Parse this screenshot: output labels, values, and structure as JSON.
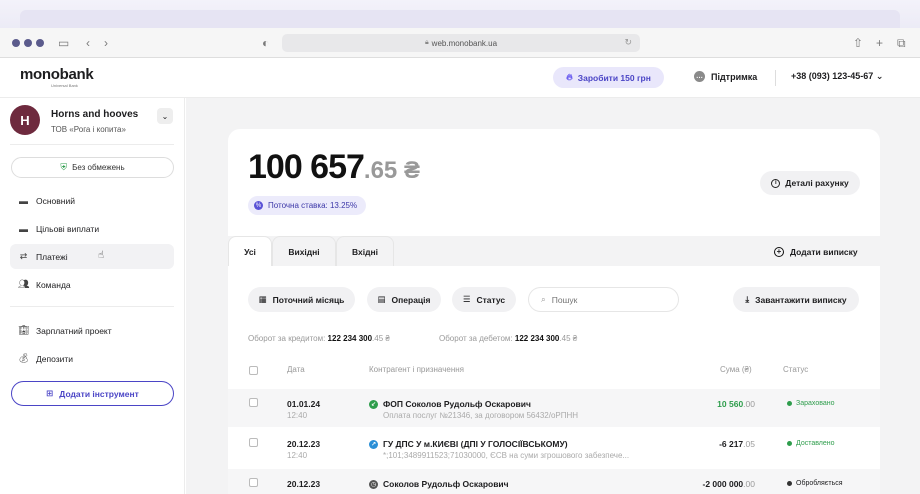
{
  "browser": {
    "url": "web.monobank.ua"
  },
  "header": {
    "logo": "monobank",
    "logo_sub": "Universal Bank",
    "earn_label": "Заробити 150 грн",
    "support_label": "Підтримка",
    "phone": "+38 (093) 123-45-67"
  },
  "company": {
    "avatar_letter": "H",
    "name": "Horns and hooves",
    "subtitle": "ТОВ «Рога і копита»"
  },
  "sidebar": {
    "limits_label": "Без обмежень",
    "items": [
      {
        "label": "Основний",
        "icon": "card-icon"
      },
      {
        "label": "Цільові виплати",
        "icon": "card-icon"
      },
      {
        "label": "Платежі",
        "icon": "transfer-icon"
      },
      {
        "label": "Команда",
        "icon": "team-icon"
      },
      {
        "label": "Зарплатний проект",
        "icon": "building-icon"
      },
      {
        "label": "Депозити",
        "icon": "moneybag-icon"
      }
    ],
    "add_tool_label": "Додати інструмент"
  },
  "account": {
    "balance_main": "100 657",
    "balance_cents": ".65 ₴",
    "rate_label": "Поточна ставка: 13.25%",
    "details_label": "Деталі рахунку"
  },
  "tabs": [
    "Усі",
    "Вихідні",
    "Вхідні"
  ],
  "add_extract_label": "Додати виписку",
  "filters": {
    "month": "Поточний місяць",
    "operation": "Операція",
    "status": "Статус",
    "search_placeholder": "Пошук",
    "download": "Завантажити виписку"
  },
  "turnover": {
    "credit_label": "Оборот за кредитом:",
    "credit_value": "122 234 300",
    "credit_cents": ".45 ₴",
    "debit_label": "Оборот за дебетом:",
    "debit_value": "122 234 300",
    "debit_cents": ".45 ₴"
  },
  "table": {
    "headers": {
      "date": "Дата",
      "counterparty": "Контрагент і призначення",
      "amount": "Сума (₴)",
      "status": "Статус"
    },
    "rows": [
      {
        "date": "01.01.24",
        "time": "12:40",
        "counterparty": "ФОП Соколов Рудольф Оскарович",
        "purpose": "Оплата послуг №21346, за договором 56432/оРПНН",
        "amount": "10 560",
        "cents": ".00",
        "status": "Зараховано",
        "amount_color": "#2e9d4c",
        "status_color": "#2e9d4c",
        "icon_color": "#2e9d4c"
      },
      {
        "date": "20.12.23",
        "time": "12:40",
        "counterparty": "ГУ ДПС У м.КИЄВІ (ДПІ У ГОЛОСІЇВСЬКОМУ)",
        "purpose": "*;101;3489911523;71030000, ЄСВ на суми згрошового забезпече...",
        "amount": "-6 217",
        "cents": ".05",
        "status": "Доставлено",
        "amount_color": "#111111",
        "status_color": "#2e9d4c",
        "icon_color": "#2b8fd6"
      },
      {
        "date": "20.12.23",
        "time": "",
        "counterparty": "Соколов Рудольф Оскарович",
        "purpose": "",
        "amount": "-2 000 000",
        "cents": ".00",
        "status": "Обробляється",
        "amount_color": "#111111",
        "status_color": "#333333",
        "icon_color": "#555555"
      }
    ]
  }
}
